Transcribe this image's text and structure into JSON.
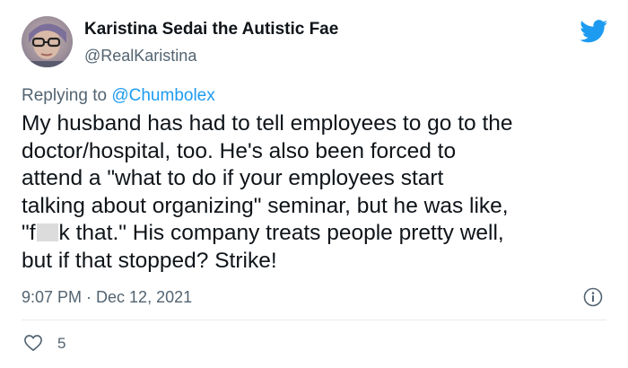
{
  "author": {
    "name": "Karistina Sedai the Autistic Fae",
    "handle": "@RealKaristina"
  },
  "reply": {
    "prefix": "Replying to ",
    "mention": "@Chumbolex"
  },
  "body": {
    "line1": "My husband has had to tell employees to go to the",
    "line2": "doctor/hospital, too. He's also been forced to",
    "line3": "attend a \"what to do if your employees start",
    "line4": "talking about organizing\" seminar, but he was like,",
    "line5_before": "\"f",
    "line5_after": "k that.\" His company treats people pretty well,",
    "line6": "but if that stopped? Strike!"
  },
  "meta": {
    "timestamp": "9:07 PM · Dec 12, 2021"
  },
  "likes": {
    "count": "5"
  },
  "icons": {
    "bird": "twitter-bird-icon",
    "info": "info-icon",
    "heart": "heart-icon"
  },
  "colors": {
    "accent": "#1d9bf0",
    "secondary_text": "#536471",
    "primary_text": "#0f1419",
    "divider": "#e6ecf0"
  }
}
